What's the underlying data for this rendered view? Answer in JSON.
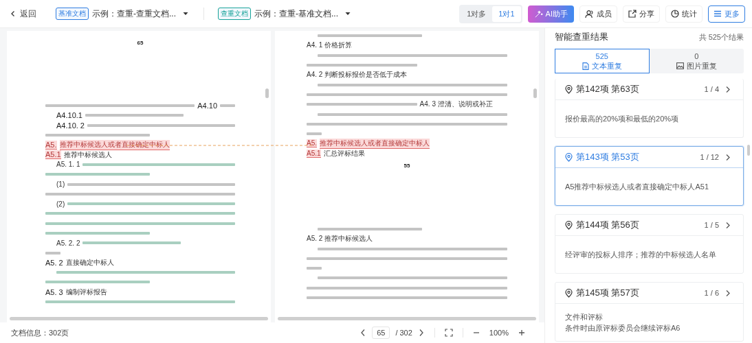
{
  "toolbar": {
    "back": "返回",
    "docs": [
      {
        "tag": "基准文档",
        "color": "#2f7de1",
        "name": "示例：查重-查重文档..."
      },
      {
        "tag": "查重文档",
        "color": "#17a398",
        "name": "示例：查重-基准文档..."
      }
    ],
    "mode_toggle": [
      {
        "label": "1对多",
        "selected": false
      },
      {
        "label": "1对1",
        "selected": true
      }
    ],
    "ai_button": "AI助手",
    "actions": [
      {
        "label": "成员",
        "kind": "members"
      },
      {
        "label": "分享",
        "kind": "share"
      },
      {
        "label": "统计",
        "kind": "stats"
      },
      {
        "label": "更多",
        "kind": "more"
      }
    ]
  },
  "documents": [
    {
      "lines": [
        {
          "kind": "page-number",
          "text": "65"
        },
        {
          "kind": "gap"
        },
        {
          "kind": "line",
          "indent": false,
          "segs": [
            {
              "kind": "blur-long",
              "duplicate": false,
              "similar": false
            },
            {
              "kind": "heading",
              "text": "A4.10",
              "duplicate": false,
              "similar": false
            },
            {
              "kind": "blur-short",
              "duplicate": false,
              "similar": false
            }
          ]
        },
        {
          "kind": "line",
          "indent": true,
          "segs": [
            {
              "kind": "heading",
              "text": "A4.10.1",
              "duplicate": false,
              "similar": false
            },
            {
              "kind": "blur-mid",
              "duplicate": false,
              "similar": false
            }
          ]
        },
        {
          "kind": "line",
          "indent": true,
          "segs": [
            {
              "kind": "heading",
              "text": "A4.10. 2",
              "duplicate": false,
              "similar": false
            },
            {
              "kind": "blur-long",
              "duplicate": false,
              "similar": false
            }
          ]
        },
        {
          "kind": "line",
          "indent": false,
          "segs": [
            {
              "kind": "blur-mid",
              "duplicate": false,
              "similar": false
            }
          ]
        },
        {
          "kind": "line",
          "indent": false,
          "segs": [
            {
              "kind": "heading",
              "text": "A5.",
              "duplicate": true,
              "similar": false
            },
            {
              "kind": "text",
              "text": "推荐中标候选人或者直接确定中标人",
              "duplicate": true,
              "similar": false
            }
          ]
        },
        {
          "kind": "line",
          "indent": false,
          "segs": [
            {
              "kind": "heading",
              "text": "A5.1",
              "duplicate": true,
              "similar": false
            },
            {
              "kind": "text",
              "text": "推荐中标候选人",
              "duplicate": false,
              "similar": false
            }
          ]
        },
        {
          "kind": "line",
          "indent": true,
          "segs": [
            {
              "kind": "text",
              "text": "A5. 1. 1",
              "duplicate": false,
              "similar": false
            },
            {
              "kind": "blur-long",
              "duplicate": false,
              "similar": true
            }
          ]
        },
        {
          "kind": "line",
          "indent": false,
          "segs": [
            {
              "kind": "blur-mid",
              "duplicate": false,
              "similar": true
            }
          ]
        },
        {
          "kind": "line",
          "indent": true,
          "segs": [
            {
              "kind": "text",
              "text": "(1)",
              "duplicate": false,
              "similar": false
            },
            {
              "kind": "blur-long",
              "duplicate": false,
              "similar": false
            }
          ]
        },
        {
          "kind": "line",
          "indent": false,
          "segs": [
            {
              "kind": "blur-long",
              "duplicate": false,
              "similar": false
            }
          ]
        },
        {
          "kind": "line",
          "indent": true,
          "segs": [
            {
              "kind": "text",
              "text": "(2)",
              "duplicate": false,
              "similar": false
            },
            {
              "kind": "blur-long",
              "duplicate": false,
              "similar": true
            }
          ]
        },
        {
          "kind": "line",
          "indent": false,
          "segs": [
            {
              "kind": "blur-long",
              "duplicate": false,
              "similar": true
            }
          ]
        },
        {
          "kind": "line",
          "indent": false,
          "segs": [
            {
              "kind": "blur-long",
              "duplicate": false,
              "similar": true
            }
          ]
        },
        {
          "kind": "line",
          "indent": false,
          "segs": [
            {
              "kind": "blur-mid",
              "duplicate": false,
              "similar": true
            }
          ]
        },
        {
          "kind": "line",
          "indent": true,
          "segs": [
            {
              "kind": "text",
              "text": "A5. 2. 2",
              "duplicate": false,
              "similar": false
            },
            {
              "kind": "blur-mid",
              "duplicate": false,
              "similar": true
            }
          ]
        },
        {
          "kind": "line",
          "indent": false,
          "segs": [
            {
              "kind": "blur-short",
              "duplicate": false,
              "similar": false
            }
          ]
        },
        {
          "kind": "line",
          "indent": false,
          "segs": [
            {
              "kind": "heading",
              "text": "A5. 2",
              "duplicate": false,
              "similar": false
            },
            {
              "kind": "text",
              "text": "直接确定中标人",
              "duplicate": false,
              "similar": false
            }
          ]
        },
        {
          "kind": "line",
          "indent": true,
          "segs": [
            {
              "kind": "blur-long",
              "duplicate": false,
              "similar": true
            }
          ]
        },
        {
          "kind": "line",
          "indent": false,
          "segs": [
            {
              "kind": "blur-mid",
              "duplicate": false,
              "similar": true
            }
          ]
        },
        {
          "kind": "line",
          "indent": false,
          "segs": [
            {
              "kind": "heading",
              "text": "A5. 3",
              "duplicate": false,
              "similar": false
            },
            {
              "kind": "text",
              "text": "编制评标报告",
              "duplicate": false,
              "similar": false
            }
          ]
        },
        {
          "kind": "line",
          "indent": false,
          "segs": [
            {
              "kind": "blur-long",
              "duplicate": false,
              "similar": true
            }
          ]
        }
      ]
    },
    {
      "lines": [
        {
          "kind": "line",
          "indent": true,
          "segs": [
            {
              "kind": "blur-mid",
              "duplicate": false,
              "similar": false
            }
          ]
        },
        {
          "kind": "line",
          "indent": false,
          "segs": [
            {
              "kind": "text",
              "text": "A4. 1 价格折算",
              "duplicate": false,
              "similar": false
            }
          ]
        },
        {
          "kind": "line",
          "indent": true,
          "segs": [
            {
              "kind": "blur-long",
              "duplicate": false,
              "similar": false
            }
          ]
        },
        {
          "kind": "line",
          "indent": false,
          "segs": [
            {
              "kind": "blur-mid",
              "duplicate": false,
              "similar": false
            }
          ]
        },
        {
          "kind": "line",
          "indent": false,
          "segs": [
            {
              "kind": "text",
              "text": "A4. 2 判断投标报价是否低于成本",
              "duplicate": false,
              "similar": false
            }
          ]
        },
        {
          "kind": "line",
          "indent": true,
          "segs": [
            {
              "kind": "blur-long",
              "duplicate": false,
              "similar": false
            }
          ]
        },
        {
          "kind": "line",
          "indent": false,
          "segs": [
            {
              "kind": "blur-long",
              "duplicate": false,
              "similar": false
            }
          ]
        },
        {
          "kind": "line",
          "indent": false,
          "segs": [
            {
              "kind": "blur-mid",
              "duplicate": false,
              "similar": false
            },
            {
              "kind": "text",
              "text": "A4. 3 澄清、说明或补正",
              "duplicate": false,
              "similar": false
            }
          ]
        },
        {
          "kind": "line",
          "indent": true,
          "segs": [
            {
              "kind": "blur-long",
              "duplicate": false,
              "similar": false
            }
          ]
        },
        {
          "kind": "line",
          "indent": false,
          "segs": [
            {
              "kind": "blur-long",
              "duplicate": false,
              "similar": false
            }
          ]
        },
        {
          "kind": "line",
          "indent": false,
          "segs": [
            {
              "kind": "blur-short",
              "duplicate": false,
              "similar": false
            }
          ]
        },
        {
          "kind": "line",
          "indent": false,
          "segs": [
            {
              "kind": "text",
              "text": "A5.",
              "duplicate": true,
              "similar": false
            },
            {
              "kind": "text",
              "text": "推荐中标候选人或者直接确定中标人",
              "duplicate": true,
              "similar": false
            }
          ]
        },
        {
          "kind": "line",
          "indent": false,
          "segs": [
            {
              "kind": "text",
              "text": "A5.1",
              "duplicate": true,
              "similar": false
            },
            {
              "kind": "text",
              "text": "汇总评标结果",
              "duplicate": false,
              "similar": false
            }
          ]
        },
        {
          "kind": "page-number",
          "text": "55"
        },
        {
          "kind": "gap"
        },
        {
          "kind": "line",
          "indent": true,
          "segs": [
            {
              "kind": "blur-mid",
              "duplicate": false,
              "similar": false
            }
          ]
        },
        {
          "kind": "line",
          "indent": false,
          "segs": [
            {
              "kind": "text",
              "text": "A5. 2 推荐中标候选人",
              "duplicate": false,
              "similar": false
            }
          ]
        },
        {
          "kind": "line",
          "indent": true,
          "segs": [
            {
              "kind": "blur-long",
              "duplicate": false,
              "similar": false
            }
          ]
        },
        {
          "kind": "line",
          "indent": false,
          "segs": [
            {
              "kind": "blur-long",
              "duplicate": false,
              "similar": false
            }
          ]
        },
        {
          "kind": "line",
          "indent": false,
          "segs": [
            {
              "kind": "blur-short",
              "duplicate": false,
              "similar": false
            }
          ]
        },
        {
          "kind": "line",
          "indent": true,
          "segs": [
            {
              "kind": "blur-long",
              "duplicate": false,
              "similar": false
            }
          ]
        },
        {
          "kind": "line",
          "indent": false,
          "segs": [
            {
              "kind": "blur-long",
              "duplicate": false,
              "similar": false
            }
          ]
        },
        {
          "kind": "line",
          "indent": false,
          "segs": [
            {
              "kind": "blur-long",
              "duplicate": false,
              "similar": false
            }
          ]
        }
      ]
    }
  ],
  "footer": {
    "doc_info": "文档信息：302页",
    "page": "65",
    "total": "/ 302",
    "zoom": "100%"
  },
  "results": {
    "title": "智能查重结果",
    "total": "共 525个结果",
    "tabs": [
      {
        "count": "525",
        "label": "文本重复",
        "kind": "text",
        "selected": true
      },
      {
        "count": "0",
        "label": "图片重复",
        "kind": "image",
        "selected": false
      }
    ],
    "items": [
      {
        "title": "第142项 第63页",
        "counter": "1 / 4",
        "text": [
          "报价最高的20%项和最低的20%项"
        ],
        "selected": false
      },
      {
        "title": "第143项 第53页",
        "counter": "1 / 12",
        "text": [
          "A5推荐中标候选人或者直接确定中标人A51"
        ],
        "selected": true
      },
      {
        "title": "第144项 第56页",
        "counter": "1 / 5",
        "text": [
          "经评审的投标人排序；推荐的中标候选人名单"
        ],
        "selected": false
      },
      {
        "title": "第145项 第57页",
        "counter": "1 / 6",
        "text": [
          "文件和评标",
          "条件时由原评标委员会继续评标A6"
        ],
        "selected": false
      }
    ]
  }
}
